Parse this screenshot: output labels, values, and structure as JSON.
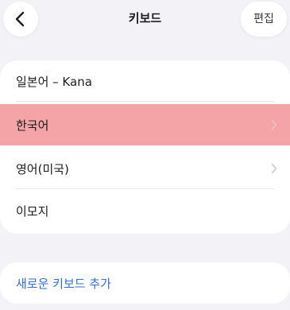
{
  "nav": {
    "title": "키보드",
    "edit_label": "편집",
    "back_icon": "chevron-left-icon"
  },
  "keyboards": [
    {
      "label": "일본어 – Kana",
      "chevron": false,
      "highlighted": false
    },
    {
      "label": "한국어",
      "chevron": true,
      "highlighted": true
    },
    {
      "label": "영어(미국)",
      "chevron": true,
      "highlighted": false
    },
    {
      "label": "이모지",
      "chevron": false,
      "highlighted": false
    }
  ],
  "add_keyboard": {
    "label": "새로운 키보드 추가"
  },
  "colors": {
    "background": "#f2f2f7",
    "highlight": "#f4a3a6",
    "link": "#2f6fe0"
  }
}
